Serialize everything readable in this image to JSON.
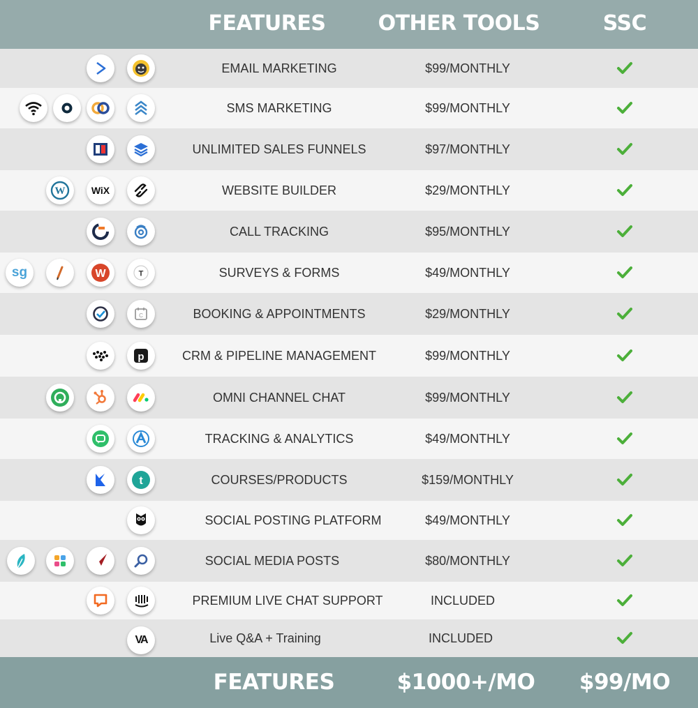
{
  "header": {
    "features_label": "FEATURES",
    "other_tools_label": "OTHER TOOLS",
    "ssc_label": "SSC"
  },
  "footer": {
    "features_label": "FEATURES",
    "other_tools_total": "$1000+/MO",
    "ssc_total": "$99/MO"
  },
  "colors": {
    "header_bar": "#96abab",
    "footer_bar": "#86a0a0",
    "check": "#4caf3a"
  },
  "check_icon": "check-icon",
  "rows": [
    {
      "feature": "EMAIL MARKETING",
      "price": "$99/MONTHLY",
      "tool_icons": [
        "activecampaign-icon",
        "mailchimp-icon"
      ]
    },
    {
      "feature": "SMS MARKETING",
      "price": "$99/MONTHLY",
      "tool_icons": [
        "wifi-icon",
        "location-pin-icon",
        "rings-icon",
        "chevrons-up-icon"
      ]
    },
    {
      "feature": "UNLIMITED SALES FUNNELS",
      "price": "$97/MONTHLY",
      "tool_icons": [
        "clickfunnels-icon",
        "layers-icon"
      ]
    },
    {
      "feature": "WEBSITE BUILDER",
      "price": "$29/MONTHLY",
      "tool_icons": [
        "wordpress-icon",
        "wix-icon",
        "squarespace-icon"
      ]
    },
    {
      "feature": "CALL TRACKING",
      "price": "$95/MONTHLY",
      "tool_icons": [
        "calltracking-icon",
        "phone-ring-icon"
      ]
    },
    {
      "feature": "SURVEYS & FORMS",
      "price": "$49/MONTHLY",
      "tool_icons": [
        "surveygizmo-icon",
        "pencil-icon",
        "wufoo-icon",
        "typeform-icon"
      ]
    },
    {
      "feature": "BOOKING & APPOINTMENTS",
      "price": "$29/MONTHLY",
      "tool_icons": [
        "calendly-icon",
        "calendar-icon"
      ]
    },
    {
      "feature": "CRM & PIPELINE MANAGEMENT",
      "price": "$99/MONTHLY",
      "tool_icons": [
        "dots-icon",
        "pipedrive-icon"
      ]
    },
    {
      "feature": "OMNI CHANNEL CHAT",
      "price": "$99/MONTHLY",
      "tool_icons": [
        "headset-icon",
        "hubspot-icon",
        "monday-icon"
      ]
    },
    {
      "feature": "TRACKING & ANALYTICS",
      "price": "$49/MONTHLY",
      "tool_icons": [
        "chat-bubble-icon",
        "analytics-icon"
      ]
    },
    {
      "feature": "COURSES/PRODUCTS",
      "price": "$159/MONTHLY",
      "tool_icons": [
        "kajabi-icon",
        "teachable-icon"
      ]
    },
    {
      "feature": "SOCIAL POSTING PLATFORM",
      "price": "$49/MONTHLY",
      "tool_icons": [
        "hootsuite-icon"
      ]
    },
    {
      "feature": "SOCIAL MEDIA POSTS",
      "price": "$80/MONTHLY",
      "tool_icons": [
        "feather-icon",
        "color-squares-icon",
        "paper-plane-icon",
        "magnifier-icon"
      ]
    },
    {
      "feature": "PREMIUM LIVE CHAT SUPPORT",
      "price": "INCLUDED",
      "tool_icons": [
        "livechat-icon",
        "intercom-icon"
      ]
    },
    {
      "feature": "Live Q&A + Training",
      "price": "INCLUDED",
      "tool_icons": [
        "va-icon"
      ]
    }
  ]
}
